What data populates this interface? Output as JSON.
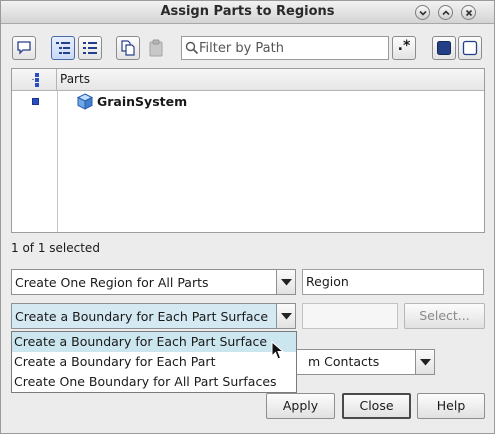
{
  "window": {
    "title": "Assign Parts to Regions"
  },
  "toolbar": {
    "filter_placeholder": "Filter by Path",
    "regex_label": ".*"
  },
  "tree": {
    "header": "Parts",
    "rows": [
      {
        "name": "GrainSystem",
        "selected": true
      }
    ]
  },
  "status": "1 of 1 selected",
  "region_mode": {
    "value": "Create One Region for All Parts"
  },
  "region_name": {
    "value": "Region"
  },
  "boundary_mode": {
    "value": "Create a Boundary for Each Part Surface",
    "options": [
      "Create a Boundary for Each Part Surface",
      "Create a Boundary for Each Part",
      "Create One Boundary for All Part Surfaces"
    ],
    "highlighted_index": 0
  },
  "boundary_field": {
    "value": ""
  },
  "select_button": "Select...",
  "contacts_combo": {
    "value": "m Contacts"
  },
  "buttons": {
    "apply": "Apply",
    "close": "Close",
    "help": "Help"
  },
  "colors": {
    "highlight": "#cce6ef",
    "field_bg": "#d4e9f1",
    "selected_marker": "#2a4ec0"
  }
}
